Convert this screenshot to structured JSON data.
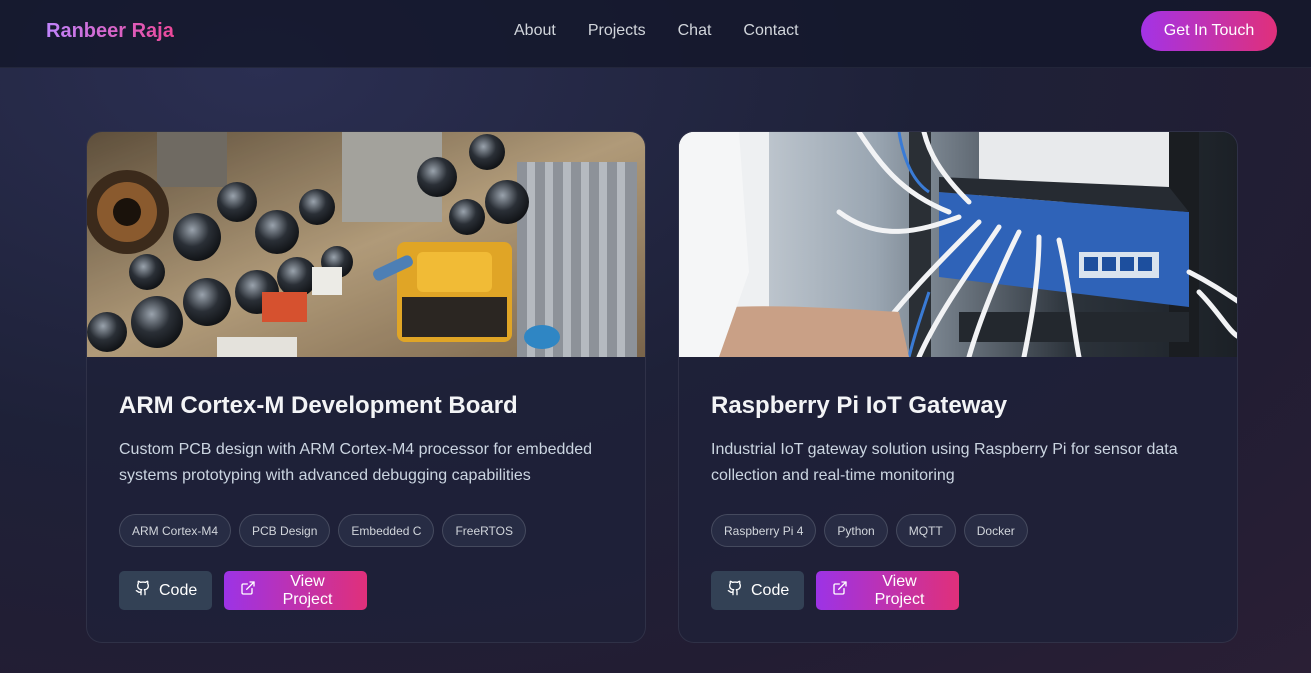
{
  "header": {
    "brand": "Ranbeer Raja",
    "nav": [
      "About",
      "Projects",
      "Chat",
      "Contact"
    ],
    "cta_label": "Get In Touch"
  },
  "projects": [
    {
      "title": "ARM Cortex-M Development Board",
      "description": "Custom PCB design with ARM Cortex-M4 processor for embedded systems prototyping with advanced debugging capabilities",
      "tags": [
        "ARM Cortex-M4",
        "PCB Design",
        "Embedded C",
        "FreeRTOS"
      ],
      "code_label": "Code",
      "view_label": "View Project"
    },
    {
      "title": "Raspberry Pi IoT Gateway",
      "description": "Industrial IoT gateway solution using Raspberry Pi for sensor data collection and real-time monitoring",
      "tags": [
        "Raspberry Pi 4",
        "Python",
        "MQTT",
        "Docker"
      ],
      "code_label": "Code",
      "view_label": "View Project"
    }
  ],
  "colors": {
    "accent_start": "#a333e6",
    "accent_end": "#e0307a",
    "code_button": "#334155"
  },
  "icons": [
    "github-icon",
    "external-link-icon"
  ]
}
